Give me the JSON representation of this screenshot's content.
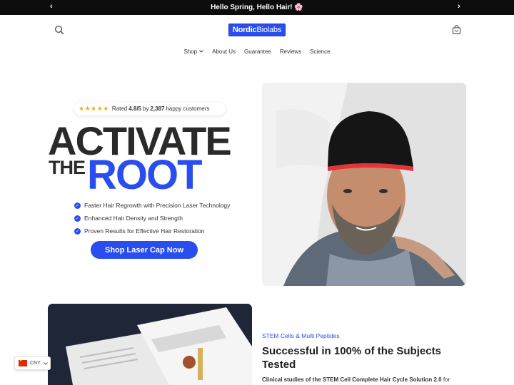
{
  "announcement": {
    "text": "Hello Spring, Hello Hair! 🌸",
    "prev_label": "‹",
    "next_label": "›"
  },
  "header": {
    "logo_bold": "Nordic",
    "logo_light": "Biolabs",
    "search_icon": "search-icon",
    "cart_icon": "bag-icon"
  },
  "nav": {
    "items": [
      {
        "label": "Shop"
      },
      {
        "label": "About Us"
      },
      {
        "label": "Guarantee"
      },
      {
        "label": "Reviews"
      },
      {
        "label": "Science"
      }
    ]
  },
  "hero": {
    "rating": {
      "stars": "★★★★★",
      "prefix": "Rated",
      "score": "4.8/5",
      "by": "by",
      "count": "2,387",
      "suffix": "happy customers"
    },
    "headline_line1": "ACTIVATE",
    "headline_the": "THE",
    "headline_root": "ROOT",
    "benefits": [
      "Faster Hair Regrowth with Precision Laser Technology",
      "Enhanced Hair Density and Strength",
      "Proven Results for Effective Hair Restoration"
    ],
    "cta_label": "Shop Laser Cap Now"
  },
  "section2": {
    "eyebrow": "STEM Cells & Multi Peptides",
    "heading": "Successful in 100% of the Subjects Tested",
    "body_prefix": "Clinical studies of the",
    "body_bold": "STEM Cell Complete Hair Cycle Solution 2.0",
    "body_suffix": "for"
  },
  "currency": {
    "code": "CNY"
  },
  "colors": {
    "accent": "#2a4df0",
    "announcement_bg": "#0c0c0c",
    "star": "#f4a81d"
  }
}
